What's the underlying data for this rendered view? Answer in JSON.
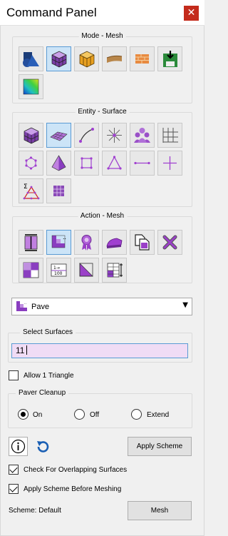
{
  "window": {
    "title": "Command Panel",
    "close_glyph": "✕"
  },
  "mode_group": {
    "label": "Mode - Mesh",
    "buttons": [
      {
        "icon": "geometry-icon",
        "selected": false
      },
      {
        "icon": "mesh-icon",
        "selected": true
      },
      {
        "icon": "hex-mesh-icon",
        "selected": false
      },
      {
        "icon": "boundary-condition-icon",
        "selected": false
      },
      {
        "icon": "material-block-icon",
        "selected": false
      },
      {
        "icon": "export-icon",
        "selected": false
      },
      {
        "icon": "quality-icon",
        "selected": false
      }
    ]
  },
  "entity_group": {
    "label": "Entity - Surface",
    "buttons": [
      {
        "icon": "volume-icon",
        "selected": false
      },
      {
        "icon": "surface-icon",
        "selected": true
      },
      {
        "icon": "curve-icon",
        "selected": false
      },
      {
        "icon": "vertex-icon",
        "selected": false
      },
      {
        "icon": "group-icon",
        "selected": false
      },
      {
        "icon": "grid-icon",
        "selected": false
      },
      {
        "icon": "node-icon",
        "selected": false
      },
      {
        "icon": "tet-icon",
        "selected": false
      },
      {
        "icon": "quad-icon",
        "selected": false
      },
      {
        "icon": "tri-icon",
        "selected": false
      },
      {
        "icon": "edge-icon",
        "selected": false
      },
      {
        "icon": "point-icon",
        "selected": false
      },
      {
        "icon": "sum-tri-icon",
        "selected": false
      },
      {
        "icon": "face-grid-icon",
        "selected": false
      }
    ]
  },
  "action_group": {
    "label": "Action - Mesh",
    "buttons": [
      {
        "icon": "interval-icon",
        "selected": false
      },
      {
        "icon": "scheme-icon",
        "selected": true
      },
      {
        "icon": "quality-ribbon-icon",
        "selected": false
      },
      {
        "icon": "smooth-iron-icon",
        "selected": false
      },
      {
        "icon": "copy-mesh-icon",
        "selected": false
      },
      {
        "icon": "delete-mesh-icon",
        "selected": false
      },
      {
        "icon": "refine-icon",
        "selected": false
      },
      {
        "icon": "count-icon",
        "selected": false
      },
      {
        "icon": "sweep-icon",
        "selected": false
      },
      {
        "icon": "sizing-icon",
        "selected": false
      }
    ]
  },
  "scheme_dropdown": {
    "selected": "Pave",
    "arrow": "▼"
  },
  "select_surfaces": {
    "label": "Select Surfaces",
    "value": "11"
  },
  "allow_triangle": {
    "label": "Allow 1 Triangle",
    "checked": false
  },
  "paver_cleanup": {
    "label": "Paver Cleanup",
    "options": [
      {
        "label": "On",
        "selected": true
      },
      {
        "label": "Off",
        "selected": false
      },
      {
        "label": "Extend",
        "selected": false
      }
    ]
  },
  "apply_scheme_button": "Apply Scheme",
  "check_overlap": {
    "label": "Check For Overlapping Surfaces",
    "checked": true
  },
  "apply_before_meshing": {
    "label": "Apply Scheme Before Meshing",
    "checked": true
  },
  "scheme_status": "Scheme: Default",
  "mesh_button": "Mesh",
  "colors": {
    "accent": "#5a9bd4",
    "field_bg": "#f0dcf5",
    "icon_purple": "#8a2be2"
  }
}
